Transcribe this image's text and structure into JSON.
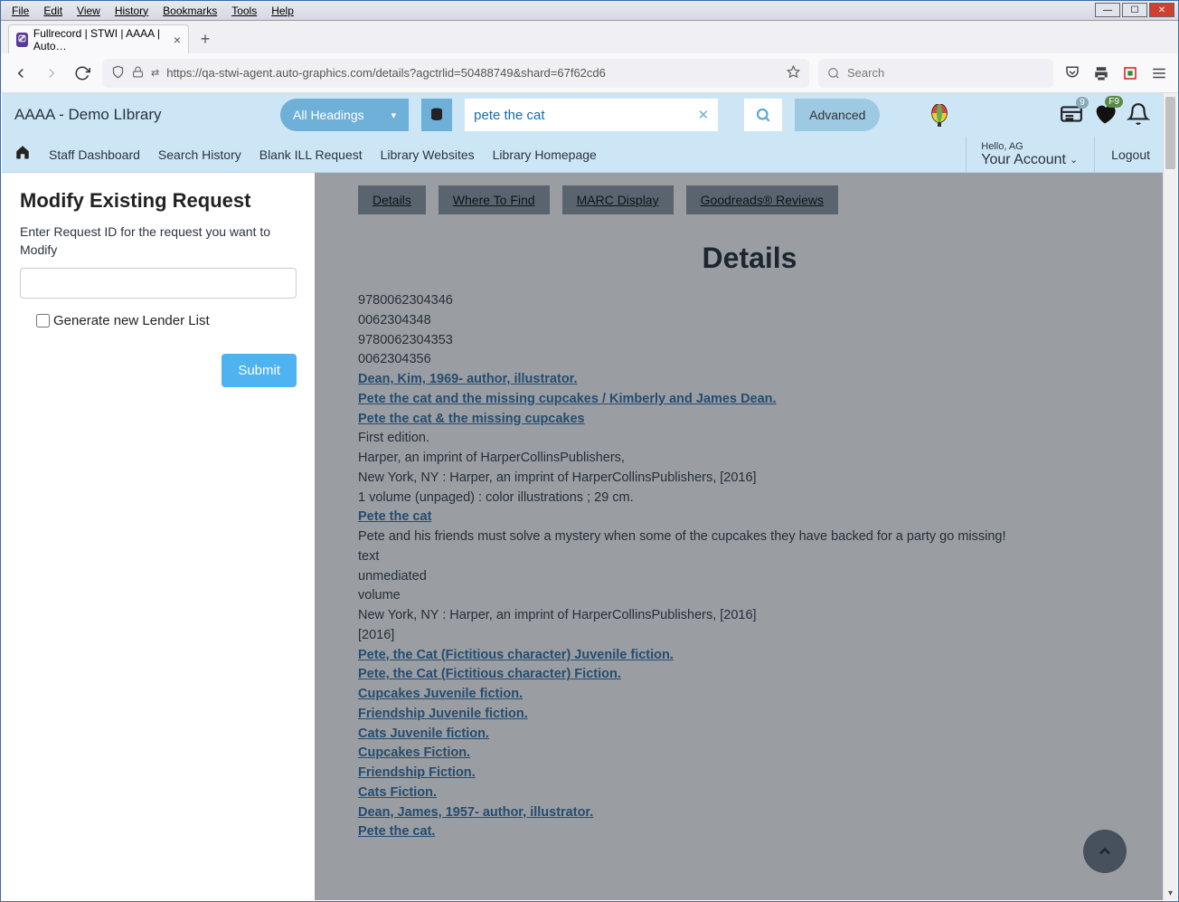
{
  "browser": {
    "menus": [
      "File",
      "Edit",
      "View",
      "History",
      "Bookmarks",
      "Tools",
      "Help"
    ],
    "tab_title": "Fullrecord | STWI | AAAA | Auto…",
    "url": "https://qa-stwi-agent.auto-graphics.com/details?agctrlid=50488749&shard=67f62cd6",
    "search_placeholder": "Search"
  },
  "header": {
    "library_name": "AAAA - Demo LIbrary",
    "search_type": "All Headings",
    "search_value": "pete the cat",
    "advanced": "Advanced",
    "inbox_badge": "9",
    "heart_badge": "F9"
  },
  "nav": {
    "items": [
      "Staff Dashboard",
      "Search History",
      "Blank ILL Request",
      "Library Websites",
      "Library Homepage"
    ],
    "hello": "Hello, AG",
    "account": "Your Account",
    "logout": "Logout"
  },
  "sidebar": {
    "title": "Modify Existing Request",
    "prompt": "Enter Request ID for the request you want to Modify",
    "checkbox_label": "Generate new Lender List",
    "submit": "Submit"
  },
  "details": {
    "tabs": [
      "Details",
      "Where To Find",
      "MARC Display",
      "Goodreads® Reviews"
    ],
    "heading": "Details",
    "lines": [
      {
        "t": "plain",
        "v": "9780062304346"
      },
      {
        "t": "plain",
        "v": "0062304348"
      },
      {
        "t": "plain",
        "v": "9780062304353"
      },
      {
        "t": "plain",
        "v": "0062304356"
      },
      {
        "t": "link",
        "v": "Dean, Kim, 1969- author, illustrator."
      },
      {
        "t": "link",
        "v": "Pete the cat and the missing cupcakes / Kimberly and James Dean."
      },
      {
        "t": "link",
        "v": "Pete the cat & the missing cupcakes"
      },
      {
        "t": "plain",
        "v": "First edition."
      },
      {
        "t": "plain",
        "v": "Harper, an imprint of HarperCollinsPublishers,"
      },
      {
        "t": "plain",
        "v": "New York, NY : Harper, an imprint of HarperCollinsPublishers, [2016]"
      },
      {
        "t": "plain",
        "v": "1 volume (unpaged) : color illustrations ; 29 cm."
      },
      {
        "t": "link",
        "v": "Pete the cat"
      },
      {
        "t": "plain",
        "v": "Pete and his friends must solve a mystery when some of the cupcakes they have backed for a party go missing!"
      },
      {
        "t": "plain",
        "v": "text"
      },
      {
        "t": "plain",
        "v": "unmediated"
      },
      {
        "t": "plain",
        "v": "volume"
      },
      {
        "t": "plain",
        "v": "New York, NY : Harper, an imprint of HarperCollinsPublishers, [2016]"
      },
      {
        "t": "plain",
        "v": "[2016]"
      },
      {
        "t": "link",
        "v": "Pete, the Cat (Fictitious character) Juvenile fiction."
      },
      {
        "t": "link",
        "v": "Pete, the Cat (Fictitious character) Fiction."
      },
      {
        "t": "link",
        "v": "Cupcakes Juvenile fiction."
      },
      {
        "t": "link",
        "v": "Friendship Juvenile fiction."
      },
      {
        "t": "link",
        "v": "Cats Juvenile fiction."
      },
      {
        "t": "link",
        "v": "Cupcakes Fiction."
      },
      {
        "t": "link",
        "v": "Friendship Fiction."
      },
      {
        "t": "link",
        "v": "Cats Fiction."
      },
      {
        "t": "link",
        "v": "Dean, James, 1957- author, illustrator."
      },
      {
        "t": "link",
        "v": "Pete the cat."
      }
    ]
  }
}
